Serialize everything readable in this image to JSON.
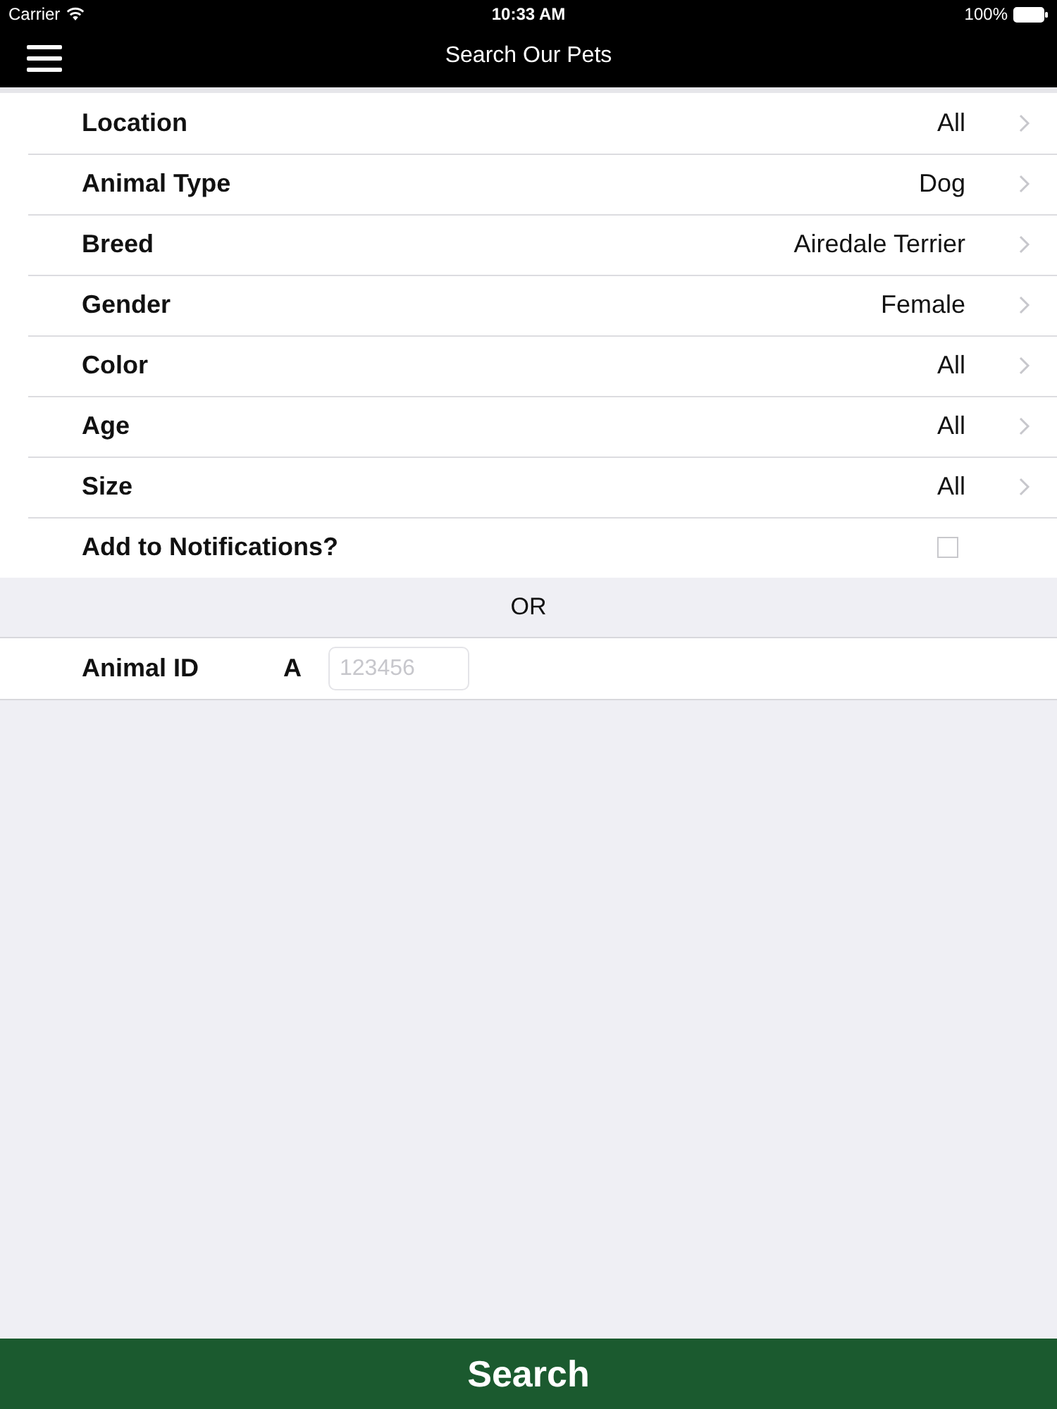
{
  "status_bar": {
    "carrier": "Carrier",
    "time": "10:33 AM",
    "battery": "100%"
  },
  "nav_bar": {
    "title": "Search Our Pets"
  },
  "rows": [
    {
      "kind": "picker",
      "label": "Location",
      "value": "All"
    },
    {
      "kind": "picker",
      "label": "Animal Type",
      "value": "Dog"
    },
    {
      "kind": "picker",
      "label": "Breed",
      "value": "Airedale Terrier"
    },
    {
      "kind": "picker",
      "label": "Gender",
      "value": "Female"
    },
    {
      "kind": "picker",
      "label": "Color",
      "value": "All"
    },
    {
      "kind": "picker",
      "label": "Age",
      "value": "All"
    },
    {
      "kind": "picker",
      "label": "Size",
      "value": "All"
    },
    {
      "kind": "checkbox",
      "label": "Add to Notifications?",
      "checked": false
    }
  ],
  "divider": "OR",
  "animal_id": {
    "label": "Animal ID",
    "prefix": "A",
    "placeholder": "123456"
  },
  "search_button": "Search"
}
